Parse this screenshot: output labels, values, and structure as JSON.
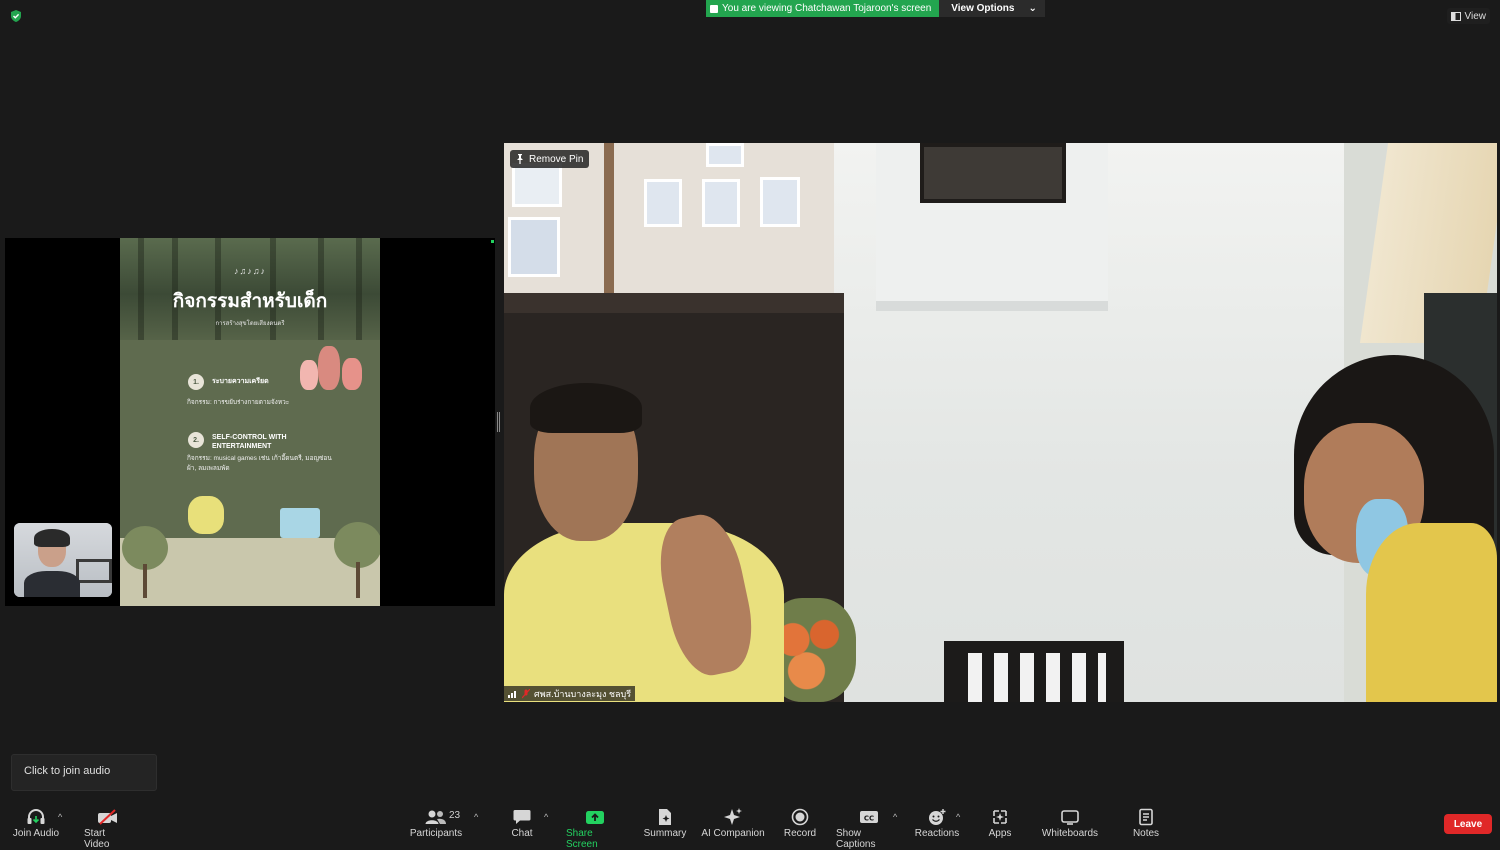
{
  "top": {
    "viewing_text": "You are viewing Chatchawan Tojaroon's screen",
    "view_options": "View Options",
    "view": "View"
  },
  "slide": {
    "title": "กิจกรรมสำหรับเด็ก",
    "subtitle": "การสร้างสุขโดยเสียงดนตรี",
    "items": [
      {
        "num": "1.",
        "heading": "ระบายความเครียด",
        "text": "กิจกรรม: การขยับร่างกายตามจังหวะ"
      },
      {
        "num": "2.",
        "heading": "SELF-CONTROL WITH ENTERTAINMENT",
        "text": "กิจกรรม: musical games เช่น เก้าอี้ดนตรี, มอญซ่อนผ้า, ลมเพลมพัด"
      }
    ]
  },
  "video": {
    "remove_pin": "Remove Pin",
    "participant_name": "ศพส.บ้านบางละมุง ชลบุรี"
  },
  "tooltip": {
    "join_audio": "Click to join audio"
  },
  "toolbar": {
    "join_audio": "Join Audio",
    "start_video": "Start Video",
    "participants": "Participants",
    "participants_count": "23",
    "chat": "Chat",
    "share_screen": "Share Screen",
    "summary": "Summary",
    "ai_companion": "AI Companion",
    "record": "Record",
    "show_captions": "Show Captions",
    "reactions": "Reactions",
    "apps": "Apps",
    "whiteboards": "Whiteboards",
    "notes": "Notes",
    "leave": "Leave"
  },
  "colors": {
    "accent_green": "#23d160",
    "leave_red": "#e02828",
    "background": "#1a1a1a"
  }
}
